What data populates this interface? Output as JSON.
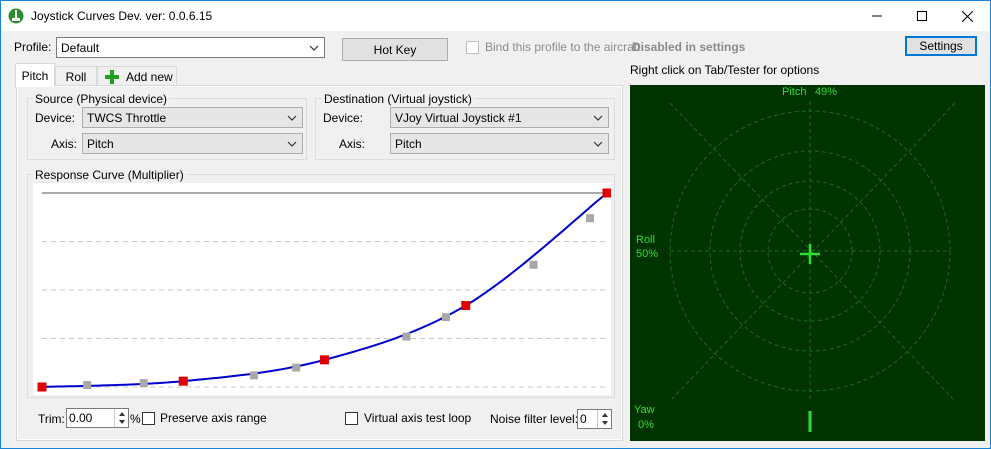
{
  "window": {
    "title": "Joystick Curves Dev. ver: 0.0.6.15",
    "minimize_glyph": "–",
    "maximize_glyph": "☐",
    "close_glyph": "✕"
  },
  "toolbar": {
    "profile_label": "Profile:",
    "profile_value": "Default",
    "hotkey_label": "Hot Key",
    "bind_label": "Bind this profile to the aircraft:",
    "bind_status": "Disabled in settings",
    "settings_label": "Settings",
    "hint": "Right click on Tab/Tester for options"
  },
  "tabs": [
    {
      "label": "Pitch",
      "active": true
    },
    {
      "label": "Roll",
      "active": false
    }
  ],
  "add_new_label": "Add new",
  "source": {
    "group_label": "Source (Physical device)",
    "device_label": "Device:",
    "device_value": "TWCS Throttle",
    "axis_label": "Axis:",
    "axis_value": "Pitch"
  },
  "destination": {
    "group_label": "Destination (Virtual joystick)",
    "device_label": "Device:",
    "device_value": "VJoy Virtual Joystick #1",
    "axis_label": "Axis:",
    "axis_value": "Pitch"
  },
  "curve": {
    "group_label": "Response Curve (Multiplier)",
    "control_points": [
      [
        0,
        0
      ],
      [
        0.25,
        0.03
      ],
      [
        0.5,
        0.14
      ],
      [
        0.75,
        0.42
      ],
      [
        1,
        1
      ]
    ],
    "intermediate_points": [
      [
        0.08,
        0.01
      ],
      [
        0.18,
        0.02
      ],
      [
        0.375,
        0.06
      ],
      [
        0.45,
        0.1
      ],
      [
        0.645,
        0.26
      ],
      [
        0.715,
        0.36
      ],
      [
        0.87,
        0.63
      ],
      [
        0.97,
        0.87
      ]
    ],
    "curve_color": "#0000cc",
    "control_color": "#e00000",
    "intermediate_color": "#a8a8a8"
  },
  "bottom": {
    "trim_label": "Trim:",
    "trim_value": "0.00",
    "percent": "%",
    "preserve_label": "Preserve axis range",
    "test_loop_label": "Virtual axis test loop",
    "noise_label": "Noise filter level:",
    "noise_value": "0"
  },
  "tester": {
    "pitch_label": "Pitch",
    "pitch_value": "49%",
    "roll_label": "Roll",
    "roll_value": "50%",
    "yaw_label": "Yaw",
    "yaw_value": "0%",
    "pitch_level": 0.49,
    "roll_level": 0.5,
    "yaw_level": 0,
    "bg_color": "#003300",
    "grid_color": "#1a6b1a",
    "accent": "#33dd33"
  }
}
